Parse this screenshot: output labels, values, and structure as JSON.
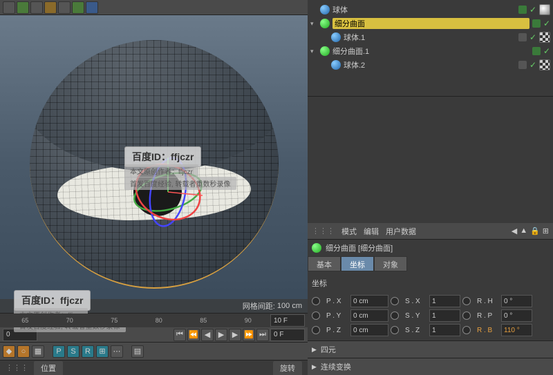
{
  "viewport": {
    "grid_label": "网格间距:",
    "grid_value": "100 cm"
  },
  "watermark": {
    "text1": "百度ID：ffjczr",
    "text2": "百度ID：ffjczr",
    "sub1": "本文原创作者：ffjczr",
    "sub2": "首发百度经验, 转载者重数秒录像"
  },
  "timeline": {
    "start": "0",
    "t65": "65",
    "t70": "70",
    "t75": "75",
    "t80": "80",
    "t85": "85",
    "t90": "90",
    "frame_current": "0 F",
    "frame_end": "10 F"
  },
  "bottom_tabs": {
    "position": "位置",
    "rotation": "旋转"
  },
  "objects": {
    "row0": {
      "name": "球体"
    },
    "row1": {
      "name": "细分曲面"
    },
    "row2": {
      "name": "球体.1"
    },
    "row3": {
      "name": "细分曲面.1"
    },
    "row4": {
      "name": "球体.2"
    }
  },
  "attr_header": {
    "mode": "模式",
    "edit": "编辑",
    "userdata": "用户数据"
  },
  "obj_title": "细分曲面 [细分曲面]",
  "tabs": {
    "basic": "基本",
    "coord": "坐标",
    "object": "对象"
  },
  "coords": {
    "section_title": "坐标",
    "px_label": "P . X",
    "px_val": "0 cm",
    "py_label": "P . Y",
    "py_val": "0 cm",
    "pz_label": "P . Z",
    "pz_val": "0 cm",
    "sx_label": "S . X",
    "sx_val": "1",
    "sy_label": "S . Y",
    "sy_val": "1",
    "sz_label": "S . Z",
    "sz_val": "1",
    "rh_label": "R . H",
    "rh_val": "0 °",
    "rp_label": "R . P",
    "rp_val": "0 °",
    "rb_label": "R . B",
    "rb_val": "110 °"
  },
  "quaternion": "四元",
  "continue": "连续变换"
}
